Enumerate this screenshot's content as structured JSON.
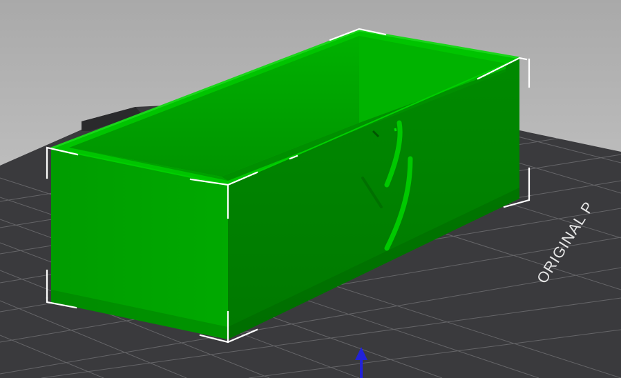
{
  "viewport": {
    "bed_label": "ORIGINAL P"
  },
  "colors": {
    "bed": "#3b3b3e",
    "grid": "#6a6a6c",
    "model_light": "#00c200",
    "model_mid": "#00a400",
    "model_dark": "#008700",
    "selection": "#ffffff",
    "axis": "#1f1fd6"
  },
  "icons": [
    "z-axis-arrow-icon"
  ]
}
